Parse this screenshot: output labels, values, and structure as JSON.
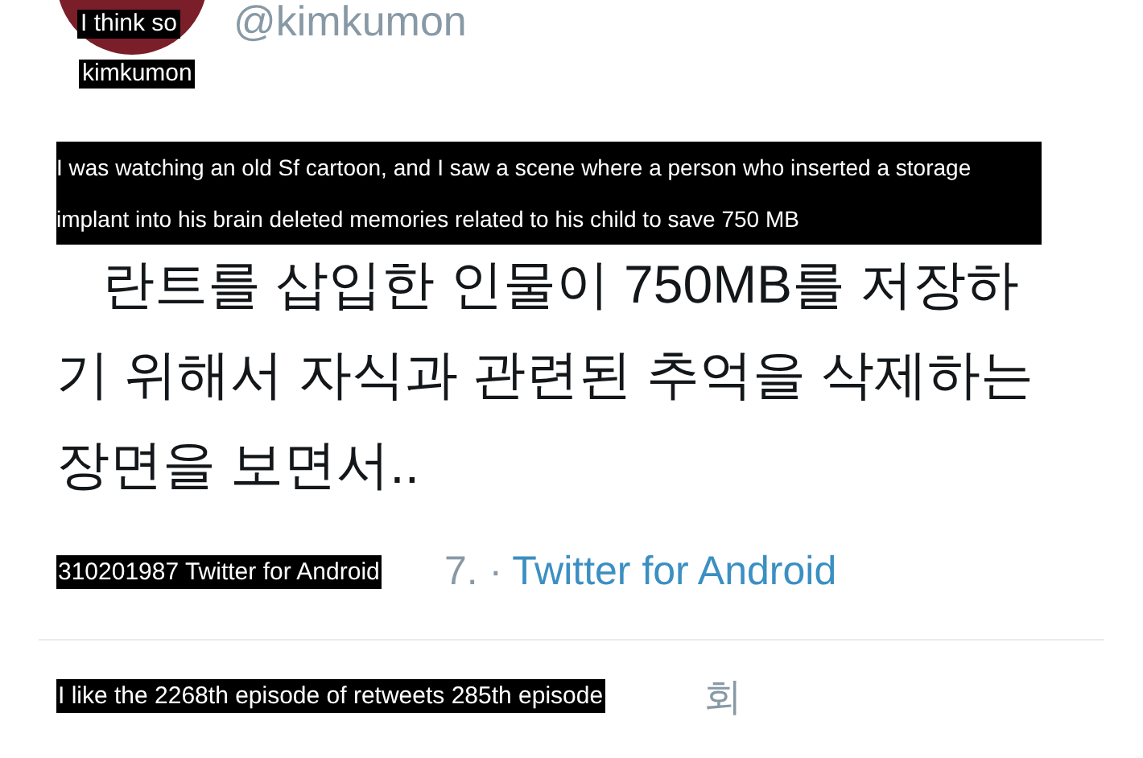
{
  "author": {
    "handle": "@kimkumon",
    "avatar_caption": "I think so",
    "name_caption": "kimkumon"
  },
  "translation": "I was watching an old Sf cartoon, and I saw a scene where a person who inserted a storage implant into his brain deleted memories related to his child to save 750 MB",
  "tweet_lines": [
    "란트를 삽입한 인물이 750MB를 저장하",
    "기 위해서 자식과 관련된 추억을 삭제하는",
    "장면을 보면서.."
  ],
  "meta": {
    "caption": "310201987 Twitter for Android",
    "date_tail": "7. ·",
    "source": "Twitter for Android"
  },
  "stats": {
    "caption": "I like the 2268th episode of retweets 285th episode",
    "tail": "회"
  }
}
